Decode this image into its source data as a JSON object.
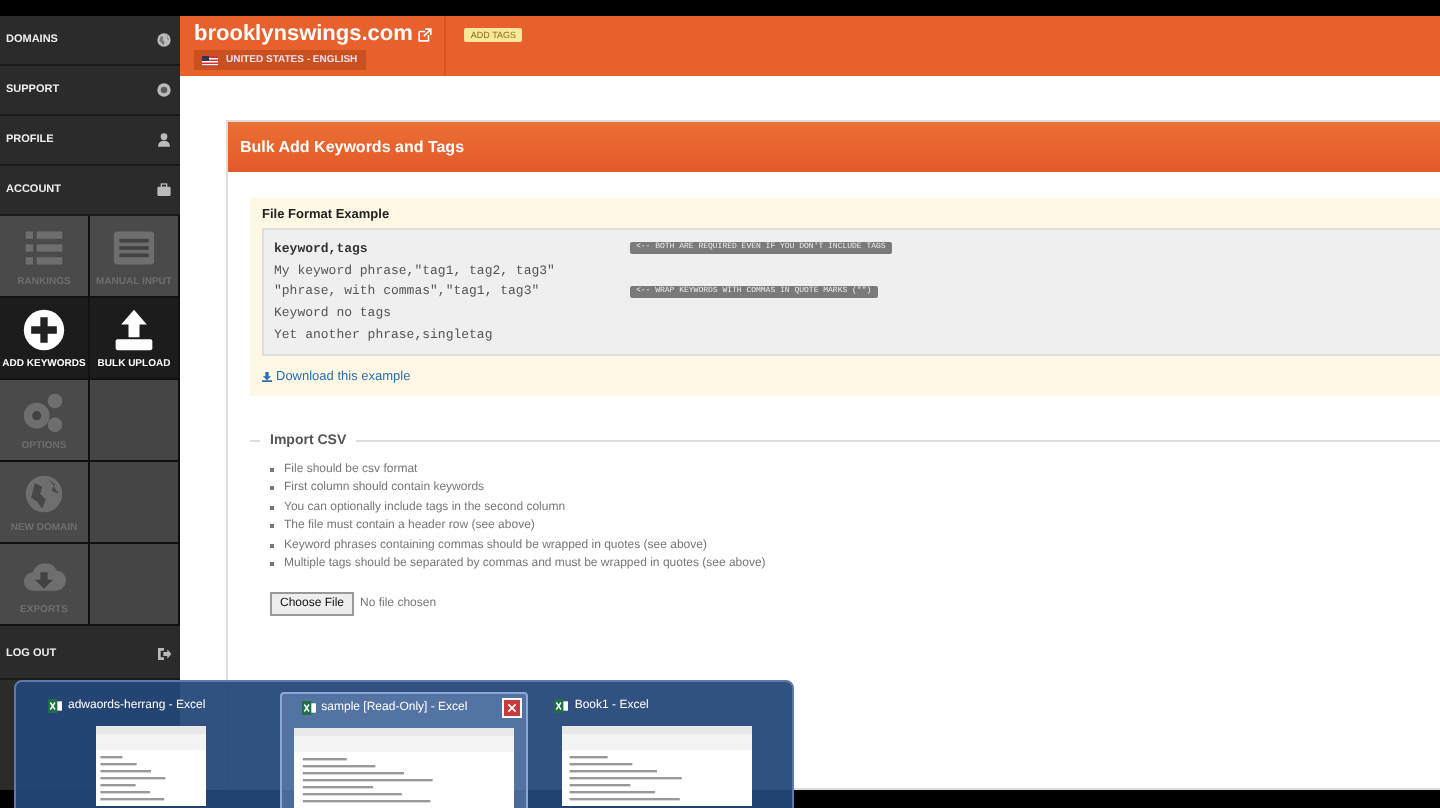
{
  "sidebar": {
    "nav": [
      {
        "label": "DOMAINS"
      },
      {
        "label": "SUPPORT"
      },
      {
        "label": "PROFILE"
      },
      {
        "label": "ACCOUNT"
      }
    ],
    "tiles": [
      {
        "kind": "tile",
        "label": "RANKINGS",
        "disabled": true
      },
      {
        "kind": "tile",
        "label": "MANUAL INPUT",
        "disabled": true
      },
      {
        "kind": "tile",
        "label": "ADD KEYWORDS",
        "disabled": false
      },
      {
        "kind": "tile",
        "label": "BULK UPLOAD",
        "disabled": false
      },
      {
        "kind": "tile",
        "label": "OPTIONS",
        "disabled": true
      },
      {
        "kind": "blank"
      },
      {
        "kind": "tile",
        "label": "NEW DOMAIN",
        "disabled": true
      },
      {
        "kind": "blank"
      },
      {
        "kind": "tile",
        "label": "EXPORTS",
        "disabled": true
      },
      {
        "kind": "blank"
      }
    ],
    "logout": {
      "label": "LOG OUT"
    }
  },
  "header": {
    "site": "brooklynswings.com",
    "locale": "UNITED STATES - ENGLISH",
    "badge": "ADD TAGS"
  },
  "panel": {
    "title": "Bulk Add Keywords and Tags",
    "example": {
      "heading": "File Format Example",
      "lines": [
        {
          "text": "keyword,tags",
          "bold": true,
          "note": "<-- BOTH ARE REQUIRED EVEN IF YOU DON'T INCLUDE TAGS"
        },
        {
          "text": "My keyword phrase,\"tag1, tag2, tag3\"",
          "bold": false
        },
        {
          "text": "\"phrase, with commas\",\"tag1, tag3\"",
          "bold": false,
          "note": "<-- WRAP KEYWORDS WITH COMMAS IN QUOTE MARKS (\"\")"
        },
        {
          "text": "Keyword no tags",
          "bold": false
        },
        {
          "text": "Yet another phrase,singletag",
          "bold": false
        }
      ],
      "download": "Download this example"
    },
    "import": {
      "legend": "Import CSV",
      "rules": [
        "File should be csv format",
        "First column should contain keywords",
        "You can optionally include tags in the second column",
        "The file must contain a header row (see above)",
        "Keyword phrases containing commas should be wrapped in quotes (see above)",
        "Multiple tags should be separated by commas and must be wrapped in quotes (see above)"
      ],
      "file_button": "Choose File",
      "file_status": "No file chosen"
    }
  },
  "taskbar_preview": {
    "items": [
      {
        "title": "adwaords-herrang - Excel",
        "selected": false
      },
      {
        "title": "sample  [Read-Only] - Excel",
        "selected": true
      },
      {
        "title": "Book1 - Excel",
        "selected": false
      }
    ]
  }
}
